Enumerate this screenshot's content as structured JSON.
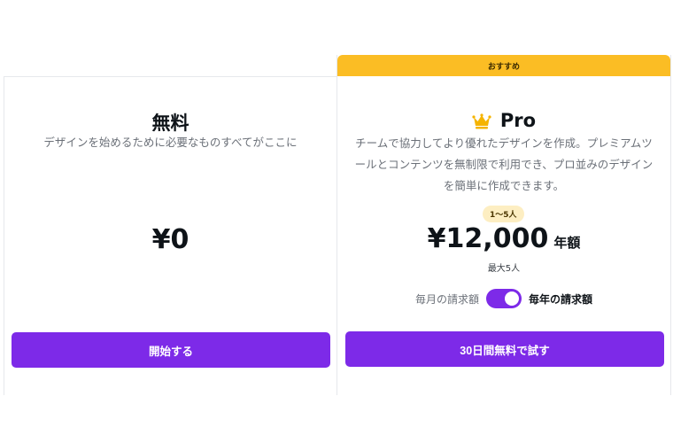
{
  "free_plan": {
    "title": "無料",
    "description": "デザインを始めるために必要なものすべてがここに",
    "price": "¥0",
    "cta_label": "開始する"
  },
  "pro_plan": {
    "ribbon_label": "おすすめ",
    "icon": "crown-icon",
    "title": "Pro",
    "description_lines": [
      "チームで協力してより優れたデザインを作成。プレミアムツ",
      "ールとコンテンツを無制限で利用でき、プロ並みのデザイン",
      "を簡単に作成できます。"
    ],
    "seats_badge": "1〜5人",
    "price": "¥12,000",
    "period": "年額",
    "max_users": "最大5人",
    "billing_monthly_label": "毎月の請求額",
    "billing_yearly_label": "毎年の請求額",
    "billing_toggle_yearly": true,
    "cta_label": "30日間無料で試す"
  },
  "colors": {
    "accent": "#7d2ae8",
    "ribbon": "#fbbd24",
    "badge": "#fdeec2",
    "crown": "#f5b400"
  }
}
